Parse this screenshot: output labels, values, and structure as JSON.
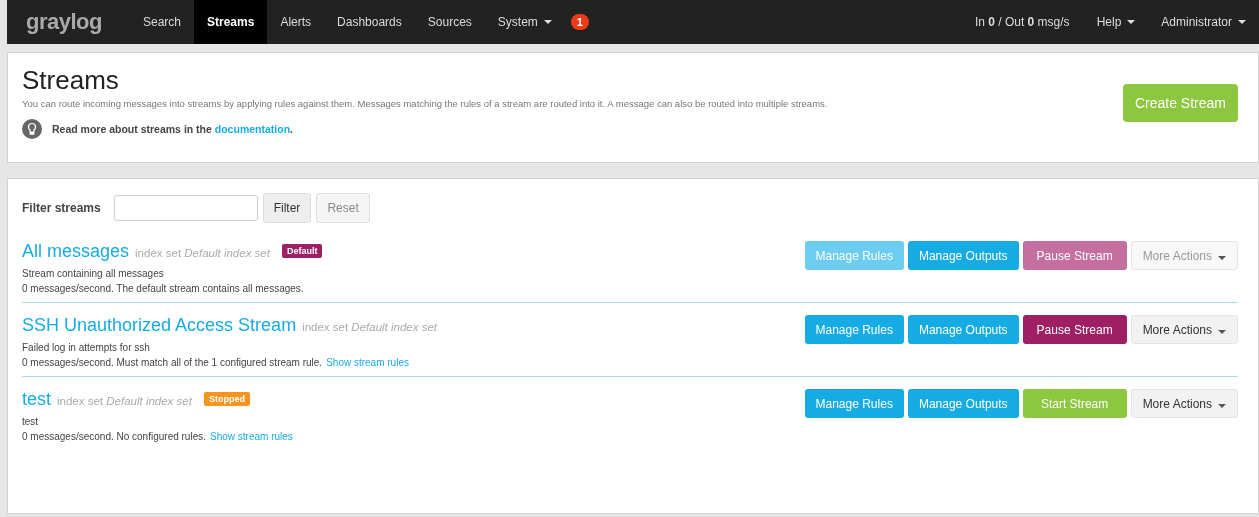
{
  "navbar": {
    "logo": "graylog",
    "items": [
      {
        "label": "Search",
        "selected": false,
        "dropdown": false
      },
      {
        "label": "Streams",
        "selected": true,
        "dropdown": false
      },
      {
        "label": "Alerts",
        "selected": false,
        "dropdown": false
      },
      {
        "label": "Dashboards",
        "selected": false,
        "dropdown": false
      },
      {
        "label": "Sources",
        "selected": false,
        "dropdown": false
      },
      {
        "label": "System",
        "selected": false,
        "dropdown": true
      }
    ],
    "notification_count": "1",
    "throughput": "In **0** / Out **0** msg/s",
    "right_menus": [
      "Help",
      "Administrator"
    ]
  },
  "header": {
    "title": "Streams",
    "description": "You can route incoming messages into streams by applying rules against them. Messages matching the rules of a stream are routed into it. A message can also be routed into multiple streams.",
    "tip_text": "Read more about streams in the",
    "tip_link": "documentation",
    "tip_end": ".",
    "create_button": "Create Stream"
  },
  "filter": {
    "label": "Filter streams",
    "filter_button": "Filter",
    "reset_button": "Reset",
    "reset_disabled": true
  },
  "streams": [
    {
      "title": "All messages",
      "index_label": "index set",
      "index_name": "Default index set",
      "badge": {
        "label": "Default",
        "kind": "default"
      },
      "description": "Stream containing all messages",
      "status": "0 messages/second. The default stream contains all messages.",
      "buttons": [
        {
          "label": "Manage Rules",
          "kind": "primary",
          "disabled": true
        },
        {
          "label": "Manage Outputs",
          "kind": "primary",
          "disabled": false
        },
        {
          "label": "Pause Stream",
          "kind": "pause",
          "disabled": true
        },
        {
          "label": "More Actions",
          "kind": "more",
          "disabled": true
        }
      ]
    },
    {
      "title": "SSH Unauthorized Access Stream",
      "index_label": "index set",
      "index_name": "Default index set",
      "description": "Failed log in attempts for ssh",
      "status": "0 messages/second. Must match all of the 1 configured stream rule.",
      "rules_link": "Show stream rules",
      "buttons": [
        {
          "label": "Manage Rules",
          "kind": "primary",
          "disabled": false
        },
        {
          "label": "Manage Outputs",
          "kind": "primary",
          "disabled": false
        },
        {
          "label": "Pause Stream",
          "kind": "pause",
          "disabled": false
        },
        {
          "label": "More Actions",
          "kind": "more",
          "disabled": false
        }
      ]
    },
    {
      "title": "test",
      "index_label": "index set",
      "index_name": "Default index set",
      "badge": {
        "label": "Stopped",
        "kind": "stopped"
      },
      "description": "test",
      "status": "0 messages/second. No configured rules.",
      "rules_link": "Show stream rules",
      "buttons": [
        {
          "label": "Manage Rules",
          "kind": "primary",
          "disabled": false
        },
        {
          "label": "Manage Outputs",
          "kind": "primary",
          "disabled": false
        },
        {
          "label": "Start Stream",
          "kind": "start",
          "disabled": false
        },
        {
          "label": "More Actions",
          "kind": "more",
          "disabled": false
        }
      ]
    }
  ]
}
